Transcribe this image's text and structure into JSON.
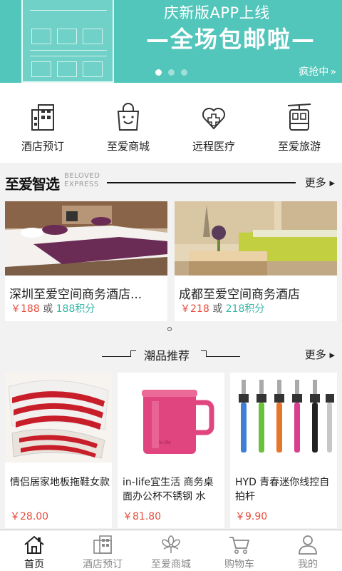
{
  "banner": {
    "title_line1": "庆新版APP上线",
    "title_line2": "—全场包邮啦—",
    "rush_label": "疯抢中",
    "rush_arrow": "»",
    "slide_count": 3,
    "active_slide": 1,
    "color": "#53c6bb"
  },
  "categories": [
    {
      "label": "酒店预订",
      "icon": "hotel-building-icon"
    },
    {
      "label": "至爱商城",
      "icon": "shopping-bag-icon"
    },
    {
      "label": "远程医疗",
      "icon": "heart-cross-icon"
    },
    {
      "label": "至爱旅游",
      "icon": "cable-car-icon"
    }
  ],
  "featured": {
    "title": "至爱智选",
    "subtitle_line1": "BELOVED",
    "subtitle_line2": "EXPRESS",
    "more_label": "更多 ▸"
  },
  "hotels": [
    {
      "name": "深圳至爱空间商务酒店...",
      "price": "￥188",
      "or": "或",
      "points": "188积分"
    },
    {
      "name": "成都至爱空间商务酒店",
      "price": "￥218",
      "or": "或",
      "points": "218积分"
    }
  ],
  "trending": {
    "title": "潮品推荐",
    "more_label": "更多 ▸"
  },
  "products": [
    {
      "name": "情侣居家地板拖鞋女款",
      "price": "￥28.00",
      "image": "striped-slippers"
    },
    {
      "name": "in-life宜生活 商务桌面办公杯不锈钢 水",
      "price": "￥81.80",
      "image": "pink-mug"
    },
    {
      "name": "HYD 青春迷你线控自拍杆",
      "price": "￥9.90",
      "image": "selfie-sticks"
    }
  ],
  "tabs": [
    {
      "label": "首页",
      "icon": "home-icon",
      "active": true
    },
    {
      "label": "酒店预订",
      "icon": "hotel-icon",
      "active": false
    },
    {
      "label": "至爱商城",
      "icon": "flower-icon",
      "active": false
    },
    {
      "label": "购物车",
      "icon": "cart-icon",
      "active": false
    },
    {
      "label": "我的",
      "icon": "user-icon",
      "active": false
    }
  ],
  "colors": {
    "accent": "#53c6bb",
    "price_red": "#e74c3c",
    "points_teal": "#36b6a8"
  }
}
